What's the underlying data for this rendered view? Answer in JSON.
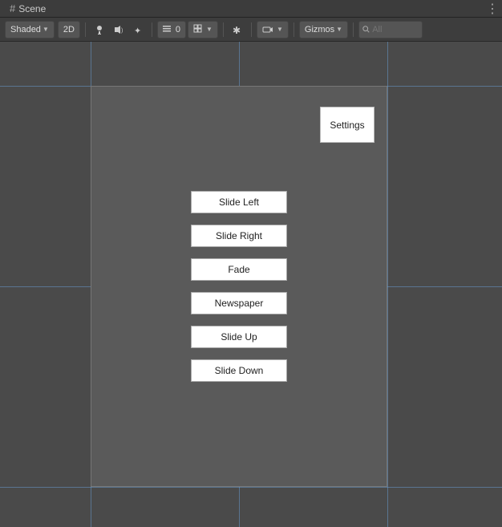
{
  "tab": {
    "icon": "#",
    "label": "Scene",
    "options_icon": "⋮"
  },
  "toolbar": {
    "shaded_label": "Shaded",
    "shaded_arrow": "▼",
    "two_d_label": "2D",
    "gizmos_label": "Gizmos",
    "gizmos_arrow": "▼",
    "search_placeholder": "All",
    "icons": {
      "light": "💡",
      "audio": "🔊",
      "effects": "✦",
      "count": "0",
      "grid": "⊞",
      "tools": "✱",
      "camera": "📷"
    }
  },
  "scene": {
    "settings_label": "Settings",
    "buttons": [
      {
        "label": "Slide Left"
      },
      {
        "label": "Slide Right"
      },
      {
        "label": "Fade"
      },
      {
        "label": "Newspaper"
      },
      {
        "label": "Slide Up"
      },
      {
        "label": "Slide Down"
      }
    ]
  }
}
